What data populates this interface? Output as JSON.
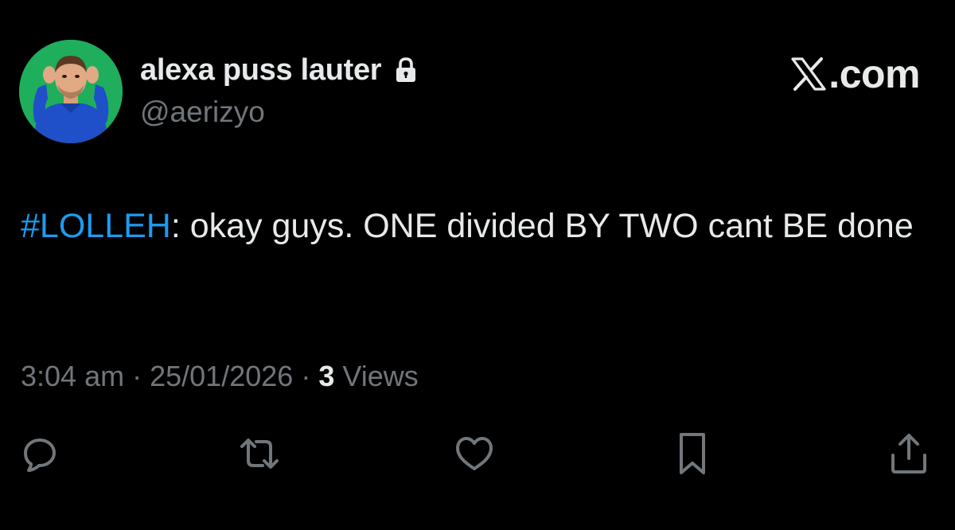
{
  "user": {
    "display_name": "alexa puss lauter",
    "handle": "@aerizyo",
    "avatar_icon": "avatar-photo",
    "protected_icon": "lock-icon"
  },
  "branding": {
    "logo_text": ".com",
    "logo_icon": "x-logo-icon"
  },
  "tweet": {
    "hashtag": "#LOLLEH",
    "text": ": okay guys. ONE divided BY TWO cant BE done",
    "time": "3:04 am",
    "date": "25/01/2026",
    "separator": "·",
    "views_count": "3",
    "views_label": "Views"
  },
  "actions": [
    {
      "name": "reply",
      "icon": "reply-icon"
    },
    {
      "name": "repost",
      "icon": "repost-icon"
    },
    {
      "name": "like",
      "icon": "heart-icon"
    },
    {
      "name": "bookmark",
      "icon": "bookmark-icon"
    },
    {
      "name": "share",
      "icon": "share-icon"
    }
  ],
  "colors": {
    "background": "#000000",
    "text_primary": "#e7e9ea",
    "text_secondary": "#71767b",
    "link": "#1d9bf0",
    "avatar_bg": "#1fae5c"
  }
}
